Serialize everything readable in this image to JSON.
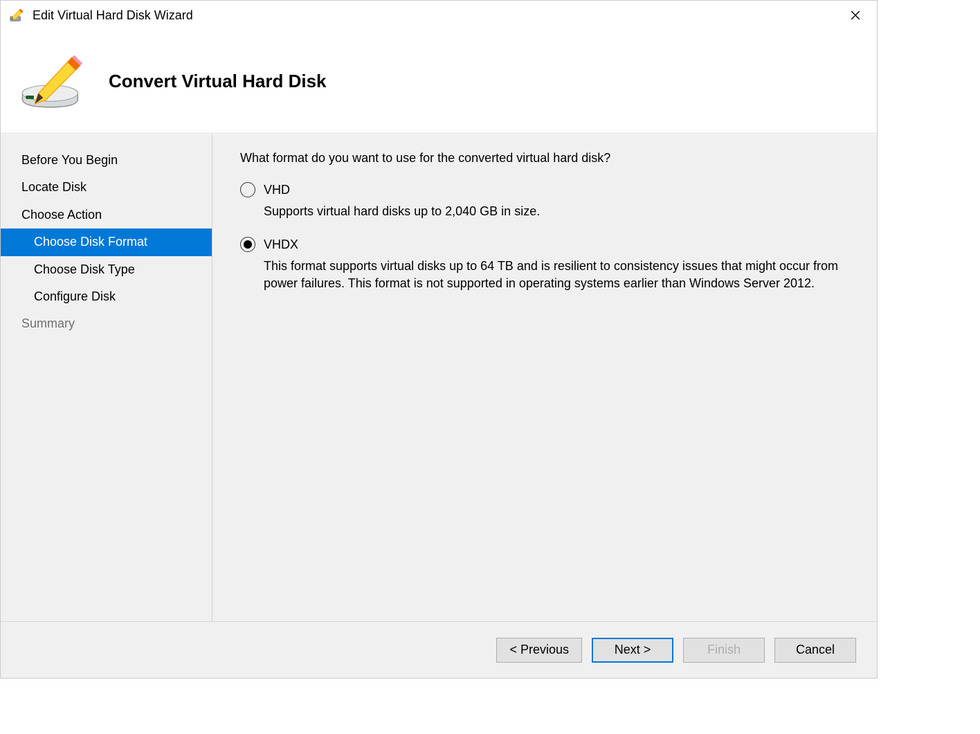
{
  "window": {
    "title": "Edit Virtual Hard Disk Wizard"
  },
  "header": {
    "page_title": "Convert Virtual Hard Disk"
  },
  "sidebar": {
    "steps": [
      {
        "label": "Before You Begin",
        "sub": false,
        "active": false,
        "dim": false
      },
      {
        "label": "Locate Disk",
        "sub": false,
        "active": false,
        "dim": false
      },
      {
        "label": "Choose Action",
        "sub": false,
        "active": false,
        "dim": false
      },
      {
        "label": "Choose Disk Format",
        "sub": true,
        "active": true,
        "dim": false
      },
      {
        "label": "Choose Disk Type",
        "sub": true,
        "active": false,
        "dim": false
      },
      {
        "label": "Configure Disk",
        "sub": true,
        "active": false,
        "dim": false
      },
      {
        "label": "Summary",
        "sub": false,
        "active": false,
        "dim": true
      }
    ]
  },
  "content": {
    "prompt": "What format do you want to use for the converted virtual hard disk?",
    "options": [
      {
        "id": "vhd",
        "label": "VHD",
        "description": "Supports virtual hard disks up to 2,040 GB in size.",
        "checked": false
      },
      {
        "id": "vhdx",
        "label": "VHDX",
        "description": "This format supports virtual disks up to 64 TB and is resilient to consistency issues that might occur from power failures. This format is not supported in operating systems earlier than Windows Server 2012.",
        "checked": true
      }
    ]
  },
  "footer": {
    "previous": "< Previous",
    "next": "Next >",
    "finish": "Finish",
    "cancel": "Cancel"
  }
}
